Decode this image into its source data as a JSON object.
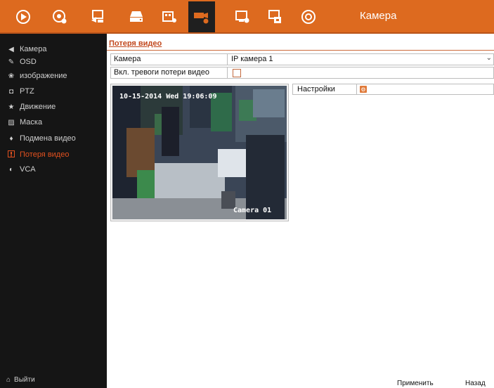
{
  "topbar": {
    "title": "Камера",
    "icons": [
      {
        "name": "live-view-icon",
        "glyph": "⦿",
        "active": false
      },
      {
        "name": "playback-icon",
        "glyph": "◎",
        "active": false
      },
      {
        "name": "remote-icon",
        "glyph": "⧉",
        "active": false
      },
      {
        "name": "hdd-icon",
        "glyph": "▤",
        "active": false
      },
      {
        "name": "record-icon",
        "glyph": "▦",
        "active": false
      },
      {
        "name": "camera-settings-icon",
        "glyph": "▬",
        "active": true
      },
      {
        "name": "system-config-icon",
        "glyph": "▣",
        "active": false
      },
      {
        "name": "network-icon",
        "glyph": "▢",
        "active": false
      },
      {
        "name": "shutdown-icon",
        "glyph": "◉",
        "active": false
      }
    ]
  },
  "sidebar": {
    "items": [
      {
        "label": "Камера",
        "icon": "camera-icon",
        "glyph": "◀",
        "active": false
      },
      {
        "label": "OSD",
        "icon": "osd-icon",
        "glyph": "✎",
        "active": false
      },
      {
        "label": "изображение",
        "icon": "image-icon",
        "glyph": "❀",
        "active": false
      },
      {
        "label": "PTZ",
        "icon": "ptz-icon",
        "glyph": "◘",
        "active": false
      },
      {
        "label": "Движение",
        "icon": "motion-icon",
        "glyph": "★",
        "active": false
      },
      {
        "label": "Маска",
        "icon": "mask-icon",
        "glyph": "▨",
        "active": false
      },
      {
        "label": "Подмена видео",
        "icon": "tamper-icon",
        "glyph": "♦",
        "active": false
      },
      {
        "label": "Потеря видео",
        "icon": "video-loss-icon",
        "glyph": "■",
        "active": true
      },
      {
        "label": "VCA",
        "icon": "vca-icon",
        "glyph": "◐",
        "active": false
      }
    ],
    "exit_label": "Выйти"
  },
  "main": {
    "tab_title": "Потеря видео",
    "camera_label": "Камера",
    "camera_value": "IP камера 1",
    "alarm_label": "Вкл. тревоги потери видео",
    "alarm_checked": false,
    "osd_date": "10-15-2014 Wed 19:06:09",
    "osd_camera": "Camera 01",
    "settings_label": "Настройки"
  },
  "footer": {
    "apply_label": "Применить",
    "back_label": "Назад"
  },
  "colors": {
    "accent": "#dd6a1f",
    "active_text": "#e0501f"
  }
}
